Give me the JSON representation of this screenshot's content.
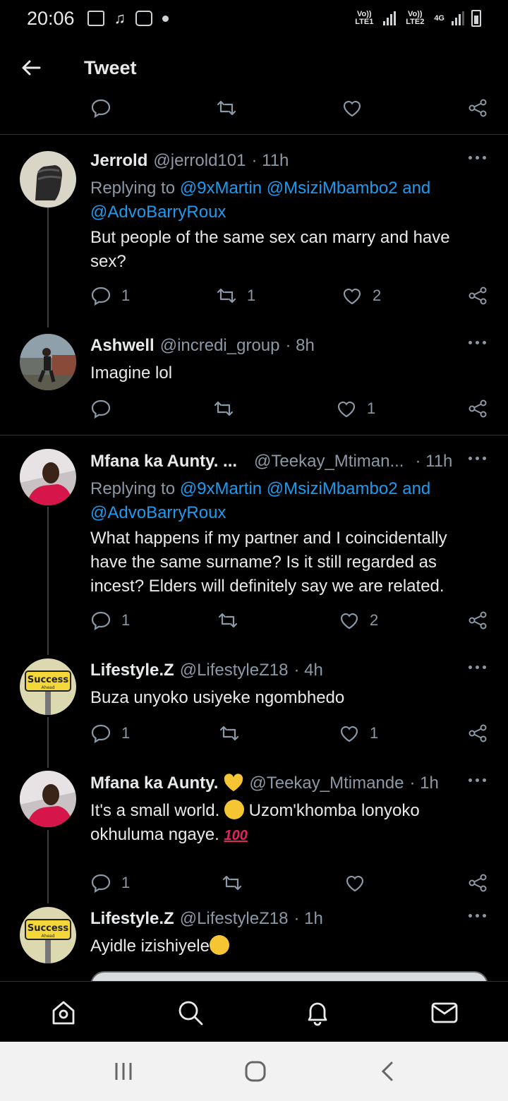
{
  "status_bar": {
    "time": "20:06",
    "sim1_label": "Vo)) LTE1",
    "sim2_label": "Vo)) LTE2",
    "network": "4G",
    "battery_level": "7"
  },
  "header": {
    "title": "Tweet"
  },
  "top_actions": {},
  "tweets": [
    {
      "name": "Jerrold",
      "handle": "@jerrold101",
      "time": "· 11h",
      "replying_prefix": "Replying to ",
      "mentions": "@9xMartin @MsiziMbambo2 and @AdvoBarryRoux",
      "text": "But people of the same sex can marry and have sex?",
      "replies": "1",
      "retweets": "1",
      "likes": "2"
    },
    {
      "name": "Ashwell",
      "handle": "@incredi_group",
      "time": "· 8h",
      "text": "Imagine lol",
      "replies": "",
      "retweets": "",
      "likes": "1"
    },
    {
      "name": "Mfana ka Aunty. ...",
      "handle": "@Teekay_Mtiman...",
      "time": "· 11h",
      "replying_prefix": "Replying to ",
      "mentions": "@9xMartin @MsiziMbambo2 and @AdvoBarryRoux",
      "text": "What happens if my partner and I coincidentally have the same surname? Is it still regarded as incest? Elders will definitely say we are related.",
      "replies": "1",
      "retweets": "",
      "likes": "2"
    },
    {
      "name": "Lifestyle.Z",
      "handle": "@LifestyleZ18",
      "time": "· 4h",
      "text": "Buza unyoko usiyeke ngombhedo",
      "replies": "1",
      "retweets": "",
      "likes": "1"
    },
    {
      "name": "Mfana ka Aunty.",
      "handle": "@Teekay_Mtimande",
      "time": "· 1h",
      "text_part1": "It's a small world. ",
      "text_part2": " Uzom'khomba lonyoko okhuluma ngaye. ",
      "emoji_100": "100",
      "replies": "1",
      "retweets": "",
      "likes": ""
    },
    {
      "name": "Lifestyle.Z",
      "handle": "@LifestyleZ18",
      "time": "· 1h",
      "text": "Ayidle izishiyele",
      "avatar_sign": "Success",
      "avatar_sign_sub": "Ahead"
    }
  ],
  "avatar_sign": {
    "main": "Success",
    "sub": "Ahead"
  },
  "bottom_nav": [
    "home-icon",
    "search-icon",
    "notifications-icon",
    "messages-icon"
  ],
  "colors": {
    "accent": "#1d9bf0",
    "muted": "#8b98a5",
    "like_heart": "#f6c533"
  }
}
